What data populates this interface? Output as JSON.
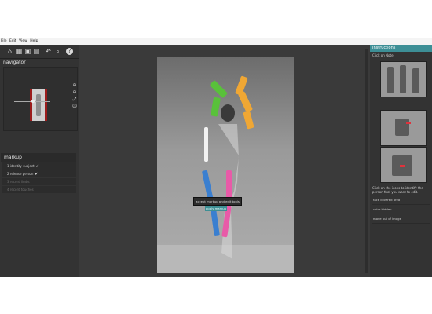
{
  "menu": [
    "File",
    "Edit",
    "View",
    "Help"
  ],
  "toolbar": {
    "icons": [
      "home-icon",
      "grid-icon",
      "image-icon",
      "layers-icon",
      "rotate-icon",
      "zoom-icon",
      "help-icon"
    ]
  },
  "navigator": {
    "title": "navigator",
    "tools": [
      "zoom-in-icon",
      "zoom-out-icon",
      "fit-icon",
      "person-icon"
    ],
    "zoom_level": 0.3
  },
  "markup": {
    "title": "markup",
    "steps": [
      {
        "label": "1  identify subject",
        "state": "done"
      },
      {
        "label": "2  release person",
        "state": "done"
      },
      {
        "label": "3  record limbs",
        "state": "disabled"
      },
      {
        "label": "4  record touches",
        "state": "disabled"
      }
    ]
  },
  "popup": {
    "text": "accept markup and edit tools",
    "button": "apply markup"
  },
  "instructions": {
    "title": "Instructions",
    "intro": "Click on Note:",
    "body": "Click on the icons to identify the person that you want to edit.",
    "items": [
      "face covered area",
      "color hidden",
      "move out of image"
    ]
  },
  "skeleton_colors": {
    "left_arm": "#59c13a",
    "right_arm": "#f0a734",
    "torso": "#f2f2f2",
    "left_leg": "#3a7fd0",
    "right_leg": "#e85aa8",
    "accent": "#3d8f96"
  }
}
